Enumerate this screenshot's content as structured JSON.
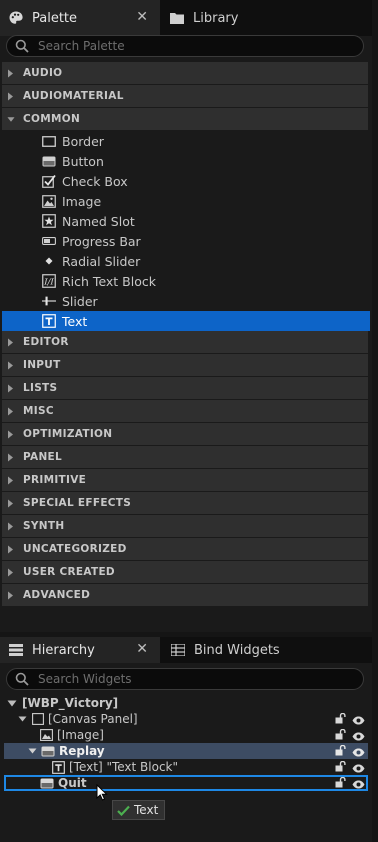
{
  "palette": {
    "tab_palette": "Palette",
    "tab_library": "Library",
    "search_placeholder": "Search Palette",
    "categories_top": [
      {
        "label": "AUDIO",
        "expanded": false
      },
      {
        "label": "AUDIOMATERIAL",
        "expanded": false
      },
      {
        "label": "COMMON",
        "expanded": true
      }
    ],
    "common_items": [
      {
        "label": "Border",
        "icon": "border-icon"
      },
      {
        "label": "Button",
        "icon": "button-icon"
      },
      {
        "label": "Check Box",
        "icon": "checkbox-icon"
      },
      {
        "label": "Image",
        "icon": "image-icon"
      },
      {
        "label": "Named Slot",
        "icon": "named-slot-icon"
      },
      {
        "label": "Progress Bar",
        "icon": "progress-bar-icon"
      },
      {
        "label": "Radial Slider",
        "icon": "radial-slider-icon"
      },
      {
        "label": "Rich Text Block",
        "icon": "rich-text-icon"
      },
      {
        "label": "Slider",
        "icon": "slider-icon"
      },
      {
        "label": "Text",
        "icon": "text-icon",
        "selected": true
      }
    ],
    "categories_bottom": [
      "EDITOR",
      "INPUT",
      "LISTS",
      "MISC",
      "OPTIMIZATION",
      "PANEL",
      "PRIMITIVE",
      "SPECIAL EFFECTS",
      "SYNTH",
      "UNCATEGORIZED",
      "USER CREATED",
      "ADVANCED"
    ]
  },
  "hierarchy": {
    "tab_hierarchy": "Hierarchy",
    "tab_bind_widgets": "Bind Widgets",
    "search_placeholder": "Search Widgets",
    "rows": [
      {
        "label": "[WBP_Victory]",
        "bold": true
      },
      {
        "label": "[Canvas Panel]"
      },
      {
        "label": "[Image]"
      },
      {
        "label": "Replay",
        "bold": true,
        "selected": true
      },
      {
        "label": "[Text] \"Text Block\""
      },
      {
        "label": "Quit",
        "bold": true,
        "focused": true
      }
    ]
  },
  "drag_tooltip": {
    "label": "Text",
    "icon": "checkmark-icon"
  },
  "colors": {
    "selection": "#0d64c8",
    "focus_outline": "#1e88e5",
    "hierarchy_selected": "#3d4c63"
  }
}
